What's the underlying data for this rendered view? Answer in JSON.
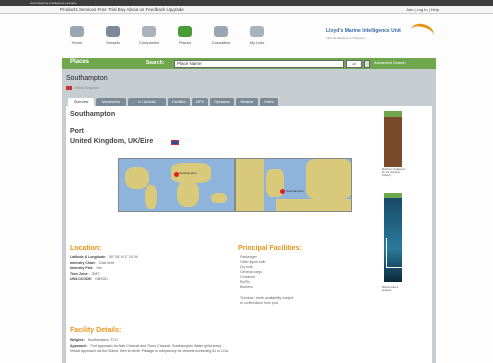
{
  "topbar": {
    "url": "www.shipping-intelligence.example"
  },
  "toolbar": {
    "links": "Products  Services  Free Trial  Buy  About us  Feedback  Upgrade",
    "right": "Join | Log in | Help"
  },
  "nav": {
    "items": [
      {
        "label": "Home",
        "icon": "home-icon",
        "color": "#9aa7b3"
      },
      {
        "label": "Vessels",
        "icon": "ship-icon",
        "color": "#7c8a98"
      },
      {
        "label": "Companies",
        "icon": "building-icon",
        "color": "#aab3bc"
      },
      {
        "label": "Places",
        "icon": "globe-icon",
        "color": "#4a9a3a"
      },
      {
        "label": "Casualties",
        "icon": "warning-icon",
        "color": "#9aa7b3"
      },
      {
        "label": "My Lists",
        "icon": "list-icon",
        "color": "#aab3bc"
      }
    ]
  },
  "brand": {
    "name": "Lloyd's Marine Intelligence Unit",
    "sub": "Informa Maritime & Transport"
  },
  "search": {
    "section_label": "Places",
    "label": "Search:",
    "value": "Place Name",
    "select": "All",
    "advanced": "Advanced Search"
  },
  "place": {
    "title": "Southampton",
    "country_link": "United Kingdom",
    "panel_title": "Southampton",
    "type": "Port",
    "country_line": "United Kingdom, UK/Eire"
  },
  "tabs": [
    "Overview",
    "Movements",
    "In / Arrivals",
    "Facilities",
    "ISPS",
    "Operators",
    "Weather",
    "Notes"
  ],
  "location": {
    "title": "Location:",
    "rows": [
      {
        "k": "Latitude & Longitude:",
        "v": "50° 54' N 1° 24' W"
      },
      {
        "k": "Intensity Chart:",
        "v": "Click here"
      },
      {
        "k": "Intensity Plot:",
        "v": "Yes"
      },
      {
        "k": "Time Zone:",
        "v": "GMT"
      },
      {
        "k": "UN/LOCODE:",
        "v": "GBSOU"
      }
    ]
  },
  "facilities": {
    "title": "Principal Facilities:",
    "items": [
      "Passenger",
      "Other liquid bulk",
      "Dry bulk",
      "General cargo",
      "Container",
      "Ro/Ro",
      "Bunkers"
    ],
    "note_lines": [
      "Terminal / berth availability subject",
      "to confirmation from port"
    ]
  },
  "facility_details": {
    "title": "Facility Details:",
    "rows": [
      {
        "k": "Weights:",
        "v": "Southampton, TCO"
      },
      {
        "k": "Approach:",
        "v": "Port approach via Nab Channel and Thorn Channel, Southampton Water (pilot area)"
      }
    ],
    "line2": "Vessel approach via the Solent, then to berth. Pilotage is compulsory for vessels exceeding 61 m LOA."
  },
  "map_labels": {
    "left": "Southampton",
    "right": "Southampton"
  },
  "ads": {
    "top_text": "Maritime intelligence for the shipping industry",
    "bottom_text": "Market data & analysis"
  }
}
